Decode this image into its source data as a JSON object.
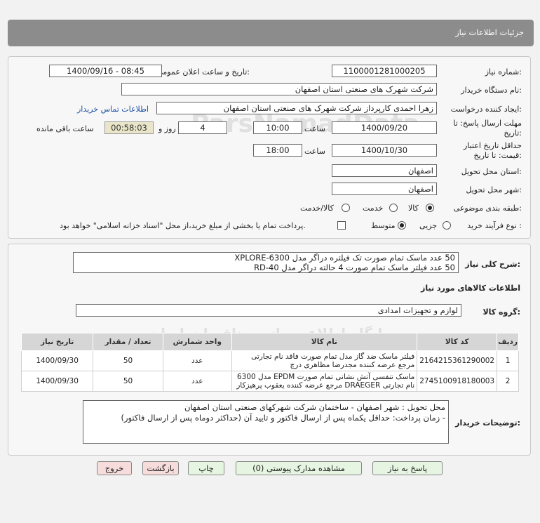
{
  "header": {
    "title": "جزئیات اطلاعات نیاز"
  },
  "info": {
    "need_number_label": "شماره نیاز:",
    "need_number": "1100001281000205",
    "announce_label": "تاریخ و ساعت اعلان عمومی:",
    "announce_value": "1400/09/16 - 08:45",
    "buyer_org_label": "نام دستگاه خریدار:",
    "buyer_org": "شرکت شهرک های صنعتی استان اصفهان",
    "creator_label": "ایجاد کننده درخواست:",
    "creator": "زهرا احمدی کارپرداز شرکت شهرک های صنعتی استان اصفهان",
    "contact_link": "اطلاعات تماس خریدار",
    "deadline_label_1": "مهلت ارسال پاسخ: تا",
    "deadline_label_2": "تاریخ:",
    "deadline_date": "1400/09/20",
    "time_label": "ساعت",
    "deadline_time": "10:00",
    "days_value": "4",
    "days_label": "روز و",
    "remaining_value": "00:58:03",
    "remaining_label": "ساعت باقی مانده",
    "validity_label_1": "حداقل تاریخ اعتبار",
    "validity_label_2": "قیمت: تا تاریخ:",
    "validity_date": "1400/10/30",
    "validity_time": "18:00",
    "province_label": "استان محل تحویل:",
    "province": "اصفهان",
    "city_label": "شهر محل تحویل:",
    "city": "اصفهان",
    "category_label": "طبقه بندی موضوعی:",
    "category_options": [
      "کالا",
      "خدمت",
      "کالا/خدمت"
    ],
    "process_label": "نوع فرآیند خرید :",
    "process_options": [
      "جزیی",
      "متوسط"
    ],
    "payment_note": "پرداخت تمام یا بخشی از مبلغ خرید،از محل \"اسناد خزانه اسلامی\" خواهد بود."
  },
  "summary": {
    "label": "شرح کلی نیاز:",
    "line1": "50 عدد ماسک تمام صورت تک فیلتره دراگر مدل XPLORE-6300",
    "line2": "50 عدد فیلتر ماسک تمام صورت 4 حالته دراگر مدل RD-40",
    "goods_info_title": "اطلاعات کالاهای مورد نیاز",
    "group_label": "گروه کالا:",
    "group_value": "لوازم و تجهیزات امدادی"
  },
  "table": {
    "headers": [
      "ردیف",
      "کد کالا",
      "نام کالا",
      "واحد شمارش",
      "تعداد / مقدار",
      "تاریخ نیاز"
    ],
    "rows": [
      {
        "idx": "1",
        "code": "2164215361290002",
        "name": "فیلتر ماسک ضد گاز مدل تمام صورت فاقد نام تجارتی مرجع عرضه کننده مجدرضا مظاهری درچ",
        "unit": "عدد",
        "qty": "50",
        "date": "1400/09/30"
      },
      {
        "idx": "2",
        "code": "2745100918180003",
        "name": "ماسک تنفسی آتش نشانی تمام صورت EPDM مدل 6300 نام تجارتی DRAEGER مرجع عرضه کننده یعقوب پرهیزکار",
        "unit": "عدد",
        "qty": "50",
        "date": "1400/09/30"
      }
    ]
  },
  "buyer_notes": {
    "label": "توضیحات خریدار:",
    "line1": "محل تحویل : شهر اصفهان - ساختمان شرکت شهرکهای صنعتی استان اصفهان",
    "line2": "- زمان پرداخت: حداقل یکماه پس از ارسال فاکتور و تایید آن (حداکثر دوماه پس از ارسال فاکتور)"
  },
  "buttons": {
    "reply": "پاسخ به نیاز",
    "attachments": "مشاهده مدارک پیوستی (0)",
    "print": "چاپ",
    "back": "بازگشت",
    "exit": "خروج"
  },
  "watermark": {
    "brand": "ParsNamadData",
    "line1": "پایگاه اطلاع رسانی مناقصات ایران",
    "line2": "۰۲۱-۸۸۳۴۹۶۷۰"
  }
}
